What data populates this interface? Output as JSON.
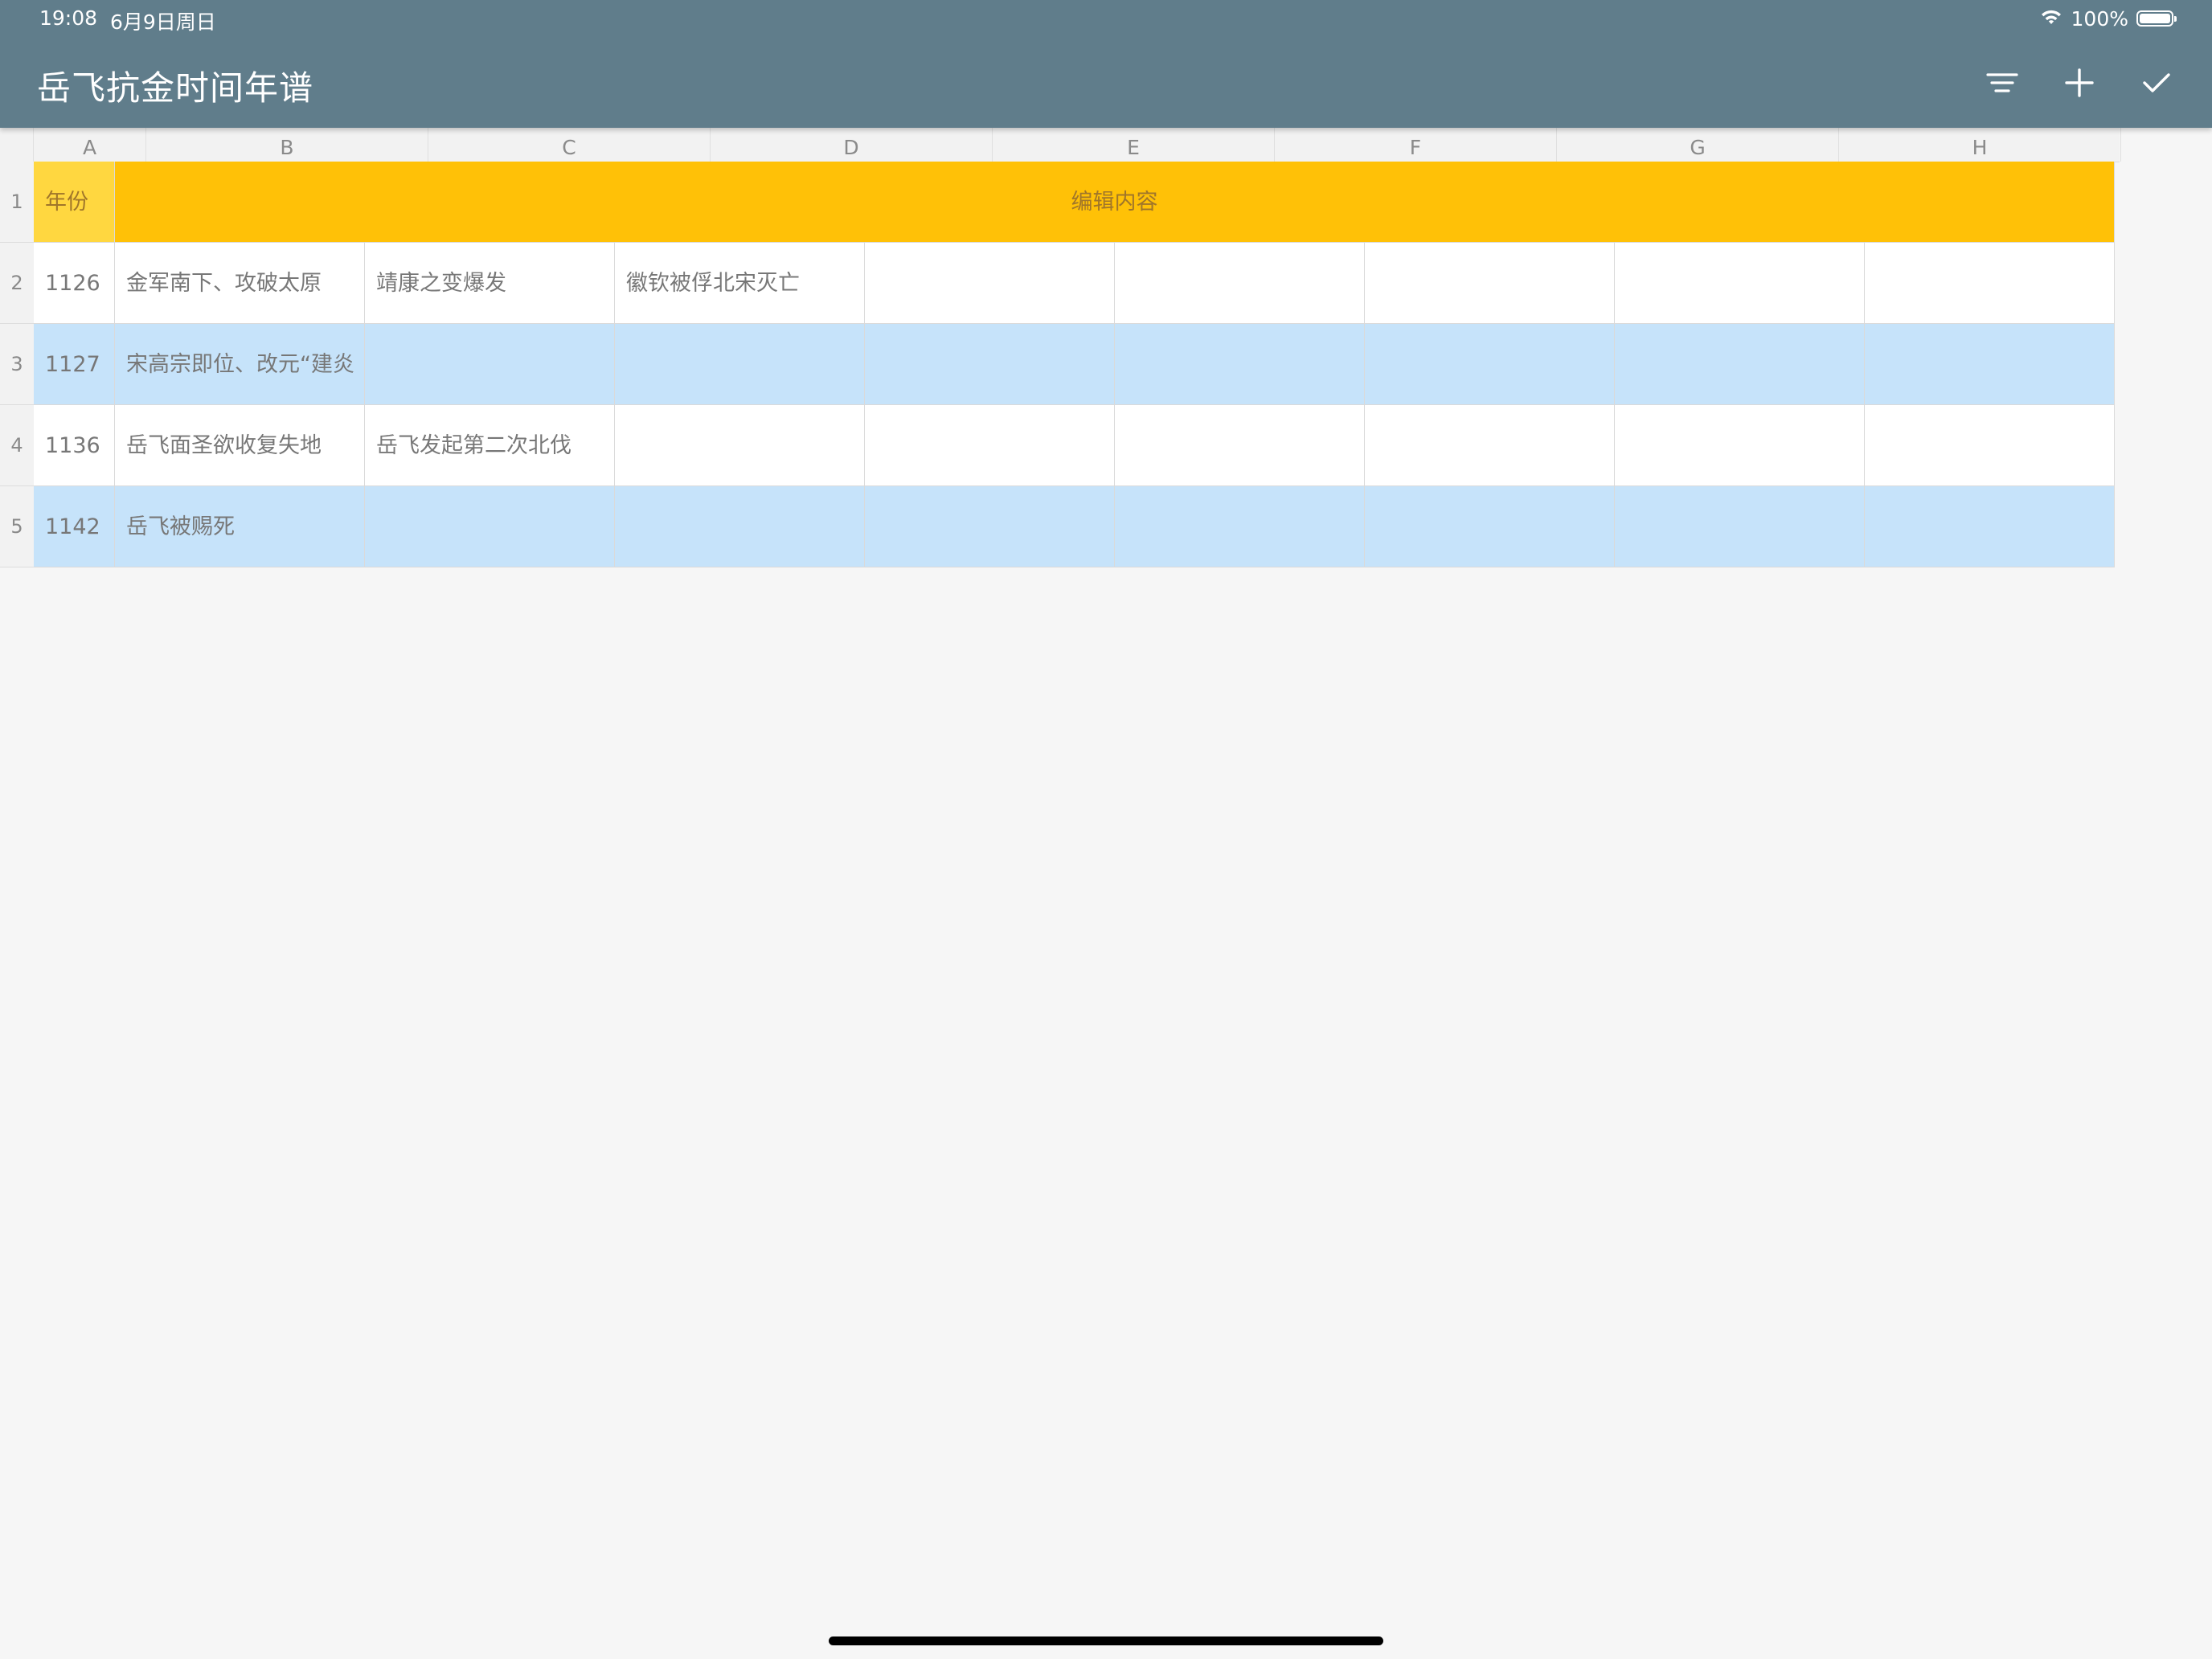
{
  "status_bar": {
    "time": "19:08",
    "date": "6月9日周日",
    "battery": "100%"
  },
  "appbar": {
    "title": "岳飞抗金时间年谱",
    "actions": [
      {
        "name": "filter-icon"
      },
      {
        "name": "add-icon"
      },
      {
        "name": "check-icon"
      }
    ]
  },
  "sheet": {
    "columns": [
      "A",
      "B",
      "C",
      "D",
      "E",
      "F",
      "G",
      "H"
    ],
    "row_numbers": [
      "1",
      "2",
      "3",
      "4",
      "5"
    ],
    "header": {
      "year": "年份",
      "content": "编辑内容"
    },
    "rows": [
      {
        "year": "1126",
        "cells": [
          "金军南下、攻破太原",
          "靖康之变爆发",
          "徽钦被俘北宋灭亡",
          "",
          "",
          "",
          "",
          ""
        ]
      },
      {
        "year": "1127",
        "cells": [
          "宋高宗即位、改元“建炎",
          "",
          "",
          "",
          "",
          "",
          "",
          ""
        ]
      },
      {
        "year": "1136",
        "cells": [
          "岳飞面圣欲收复失地",
          "岳飞发起第二次北伐",
          "",
          "",
          "",
          "",
          "",
          ""
        ]
      },
      {
        "year": "1142",
        "cells": [
          "岳飞被赐死",
          "",
          "",
          "",
          "",
          "",
          "",
          ""
        ]
      }
    ]
  },
  "colors": {
    "appbar": "#607d8b",
    "header_year": "#ffd740",
    "header_content": "#ffc107",
    "row_alt": "#c6e3fa"
  }
}
